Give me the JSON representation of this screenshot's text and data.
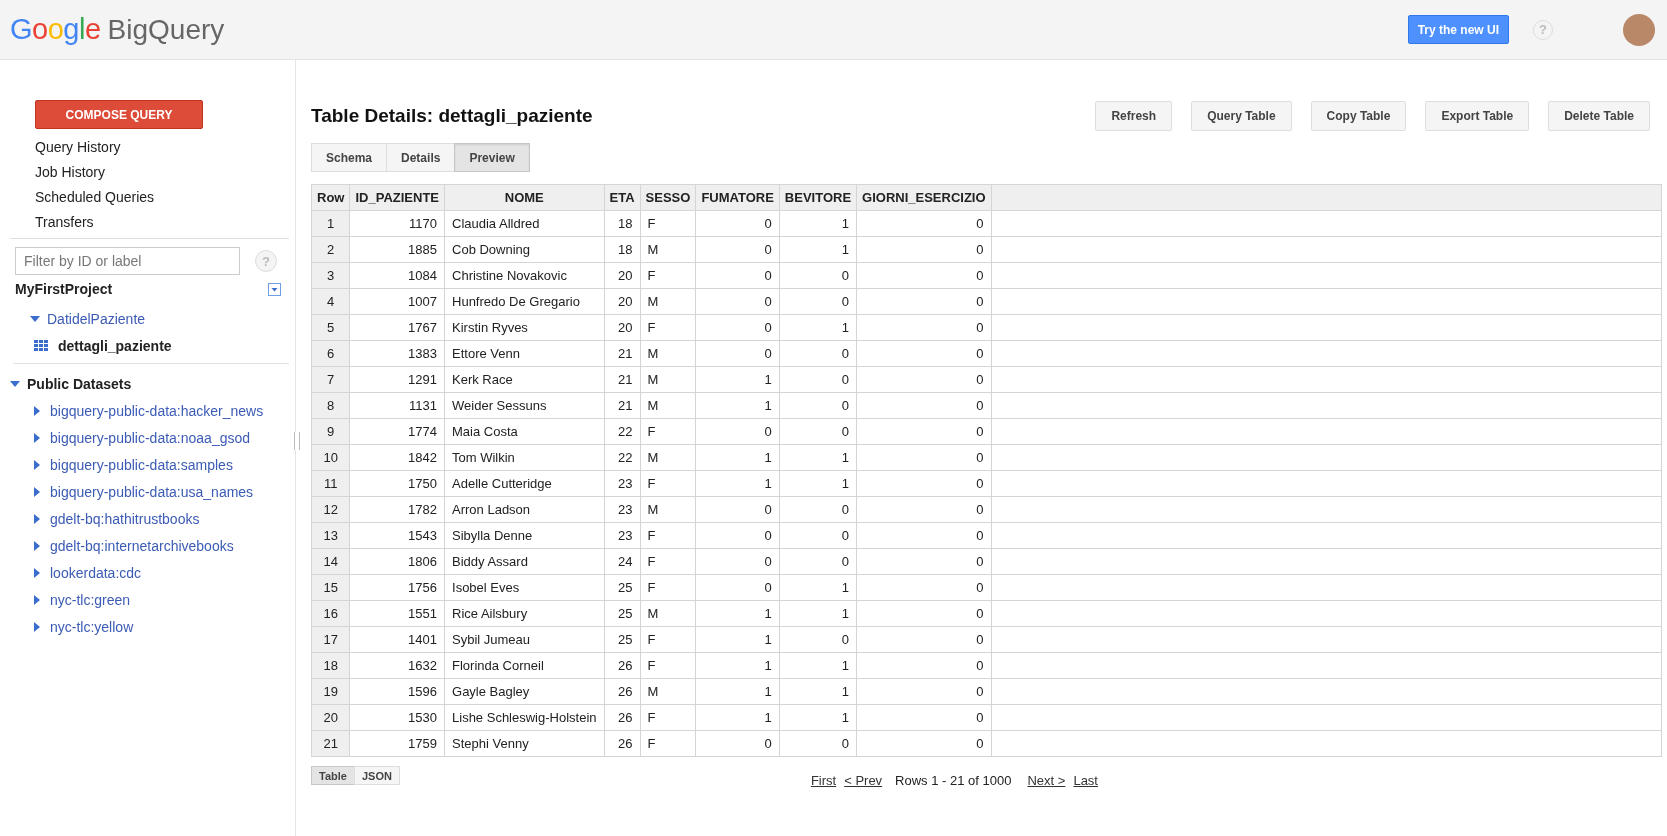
{
  "header": {
    "logo": {
      "brand": "Google",
      "product": "BigQuery"
    },
    "try_button": "Try the new UI",
    "help": "?"
  },
  "sidebar": {
    "compose_button": "COMPOSE QUERY",
    "nav": [
      "Query History",
      "Job History",
      "Scheduled Queries",
      "Transfers"
    ],
    "filter": {
      "placeholder": "Filter by ID or label"
    },
    "filter_help": "?",
    "project": {
      "name": "MyFirstProject",
      "children": [
        {
          "name": "DatidelPaziente",
          "expanded": true,
          "children": [
            {
              "name": "dettagli_paziente",
              "selected": true
            }
          ]
        }
      ]
    },
    "public": {
      "name": "Public Datasets",
      "expanded": true,
      "children": [
        {
          "name": "bigquery-public-data:hacker_news",
          "expanded": false
        },
        {
          "name": "bigquery-public-data:noaa_gsod",
          "expanded": false
        },
        {
          "name": "bigquery-public-data:samples",
          "expanded": false
        },
        {
          "name": "bigquery-public-data:usa_names",
          "expanded": false
        },
        {
          "name": "gdelt-bq:hathitrustbooks",
          "expanded": false
        },
        {
          "name": "gdelt-bq:internetarchivebooks",
          "expanded": false
        },
        {
          "name": "lookerdata:cdc",
          "expanded": false
        },
        {
          "name": "nyc-tlc:green",
          "expanded": false
        },
        {
          "name": "nyc-tlc:yellow",
          "expanded": false
        }
      ]
    }
  },
  "content": {
    "title": "Table Details: dettagli_paziente",
    "actions": [
      "Refresh",
      "Query Table",
      "Copy Table",
      "Export Table",
      "Delete Table"
    ],
    "tabs": [
      {
        "label": "Schema",
        "selected": false
      },
      {
        "label": "Details",
        "selected": false
      },
      {
        "label": "Preview",
        "selected": true
      }
    ],
    "table": {
      "columns": [
        {
          "label": "Row",
          "kind": "index"
        },
        {
          "label": "ID_PAZIENTE",
          "kind": "number"
        },
        {
          "label": "NOME",
          "kind": "text"
        },
        {
          "label": "ETA",
          "kind": "number"
        },
        {
          "label": "SESSO",
          "kind": "text"
        },
        {
          "label": "FUMATORE",
          "kind": "number"
        },
        {
          "label": "BEVITORE",
          "kind": "number"
        },
        {
          "label": "GIORNI_ESERCIZIO",
          "kind": "number"
        }
      ],
      "rows": [
        [
          "1",
          "1170",
          "Claudia Alldred",
          "18",
          "F",
          "0",
          "1",
          "0"
        ],
        [
          "2",
          "1885",
          "Cob Downing",
          "18",
          "M",
          "0",
          "1",
          "0"
        ],
        [
          "3",
          "1084",
          "Christine Novakovic",
          "20",
          "F",
          "0",
          "0",
          "0"
        ],
        [
          "4",
          "1007",
          "Hunfredo De Gregario",
          "20",
          "M",
          "0",
          "0",
          "0"
        ],
        [
          "5",
          "1767",
          "Kirstin Ryves",
          "20",
          "F",
          "0",
          "1",
          "0"
        ],
        [
          "6",
          "1383",
          "Ettore Venn",
          "21",
          "M",
          "0",
          "0",
          "0"
        ],
        [
          "7",
          "1291",
          "Kerk Race",
          "21",
          "M",
          "1",
          "0",
          "0"
        ],
        [
          "8",
          "1131",
          "Weider Sessuns",
          "21",
          "M",
          "1",
          "0",
          "0"
        ],
        [
          "9",
          "1774",
          "Maia Costa",
          "22",
          "F",
          "0",
          "0",
          "0"
        ],
        [
          "10",
          "1842",
          "Tom Wilkin",
          "22",
          "M",
          "1",
          "1",
          "0"
        ],
        [
          "11",
          "1750",
          "Adelle Cutteridge",
          "23",
          "F",
          "1",
          "1",
          "0"
        ],
        [
          "12",
          "1782",
          "Arron Ladson",
          "23",
          "M",
          "0",
          "0",
          "0"
        ],
        [
          "13",
          "1543",
          "Sibylla Denne",
          "23",
          "F",
          "0",
          "0",
          "0"
        ],
        [
          "14",
          "1806",
          "Biddy Assard",
          "24",
          "F",
          "0",
          "0",
          "0"
        ],
        [
          "15",
          "1756",
          "Isobel Eves",
          "25",
          "F",
          "0",
          "1",
          "0"
        ],
        [
          "16",
          "1551",
          "Rice Ailsbury",
          "25",
          "M",
          "1",
          "1",
          "0"
        ],
        [
          "17",
          "1401",
          "Sybil Jumeau",
          "25",
          "F",
          "1",
          "0",
          "0"
        ],
        [
          "18",
          "1632",
          "Florinda Corneil",
          "26",
          "F",
          "1",
          "1",
          "0"
        ],
        [
          "19",
          "1596",
          "Gayle Bagley",
          "26",
          "M",
          "1",
          "1",
          "0"
        ],
        [
          "20",
          "1530",
          "Lishe Schleswig-Holstein",
          "26",
          "F",
          "1",
          "1",
          "0"
        ],
        [
          "21",
          "1759",
          "Stephi Venny",
          "26",
          "F",
          "0",
          "0",
          "0"
        ]
      ]
    },
    "view_toggle": [
      {
        "label": "Table",
        "selected": true
      },
      {
        "label": "JSON",
        "selected": false
      }
    ],
    "pager": {
      "first": "First",
      "prev": "< Prev",
      "range": "Rows 1 - 21 of 1000",
      "next": "Next >",
      "last": "Last"
    }
  }
}
